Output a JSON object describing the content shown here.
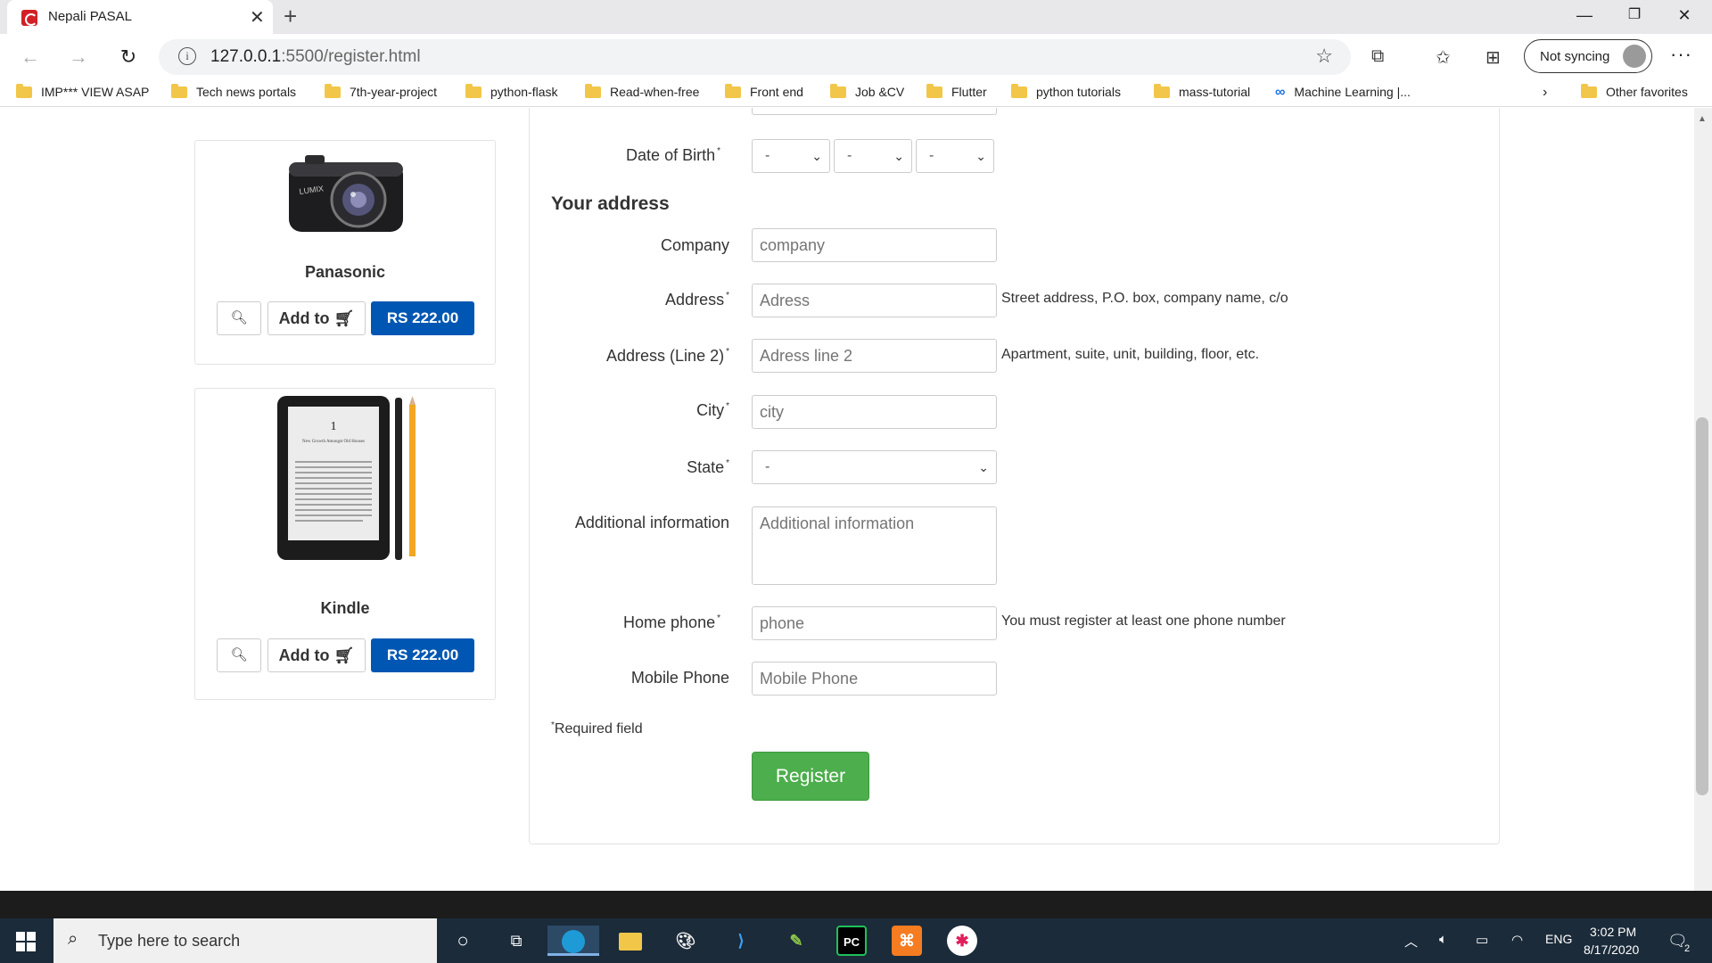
{
  "browser": {
    "tab_title": "Nepali PASAL",
    "url_host": "127.0.0.1",
    "url_path": ":5500/register.html",
    "sync_label": "Not syncing",
    "bookmarks": [
      {
        "label": "IMP*** VIEW ASAP",
        "icon": "folder-icon"
      },
      {
        "label": "Tech news portals",
        "icon": "folder-icon"
      },
      {
        "label": "7th-year-project",
        "icon": "folder-icon"
      },
      {
        "label": "python-flask",
        "icon": "folder-icon"
      },
      {
        "label": "Read-when-free",
        "icon": "folder-icon"
      },
      {
        "label": "Front end",
        "icon": "folder-icon"
      },
      {
        "label": "Job &CV",
        "icon": "folder-icon"
      },
      {
        "label": "Flutter",
        "icon": "folder-icon"
      },
      {
        "label": "python tutorials",
        "icon": "folder-icon"
      },
      {
        "label": "mass-tutorial",
        "icon": "folder-icon"
      },
      {
        "label": "Machine Learning |...",
        "icon": "colab-icon"
      }
    ],
    "other_favorites": "Other favorites"
  },
  "products": [
    {
      "name": "Panasonic",
      "add_label": "Add to",
      "price": "RS 222.00",
      "brand_text": "LUMIX"
    },
    {
      "name": "Kindle",
      "add_label": "Add to",
      "price": "RS 222.00",
      "screen_number": "1",
      "screen_heading": "New Growth Amongst Old Houses"
    }
  ],
  "form": {
    "dob_label": "Date of Birth",
    "dob_day": "-",
    "dob_month": "-",
    "dob_year": "-",
    "section_title": "Your address",
    "company_label": "Company",
    "company_placeholder": "company",
    "address_label": "Address",
    "address_placeholder": "Adress",
    "address_hint": "Street address, P.O. box, company name, c/o",
    "address2_label": "Address (Line 2)",
    "address2_placeholder": "Adress line 2",
    "address2_hint": "Apartment, suite, unit, building, floor, etc.",
    "city_label": "City",
    "city_placeholder": "city",
    "state_label": "State",
    "state_value": "-",
    "additional_label": "Additional information",
    "additional_placeholder": "Additional information",
    "home_phone_label": "Home phone",
    "home_phone_placeholder": "phone",
    "home_phone_hint": "You must register at least one phone number",
    "mobile_label": "Mobile Phone",
    "mobile_placeholder": "Mobile Phone",
    "required_note": "Required field",
    "required_mark": "*",
    "register_label": "Register"
  },
  "taskbar": {
    "search_placeholder": "Type here to search",
    "language": "ENG",
    "time": "3:02 PM",
    "date": "8/17/2020",
    "notification_count": "2"
  },
  "colors": {
    "price_button": "#0057b3",
    "register_button": "#4cae4c",
    "taskbar": "#1b2b3a"
  }
}
